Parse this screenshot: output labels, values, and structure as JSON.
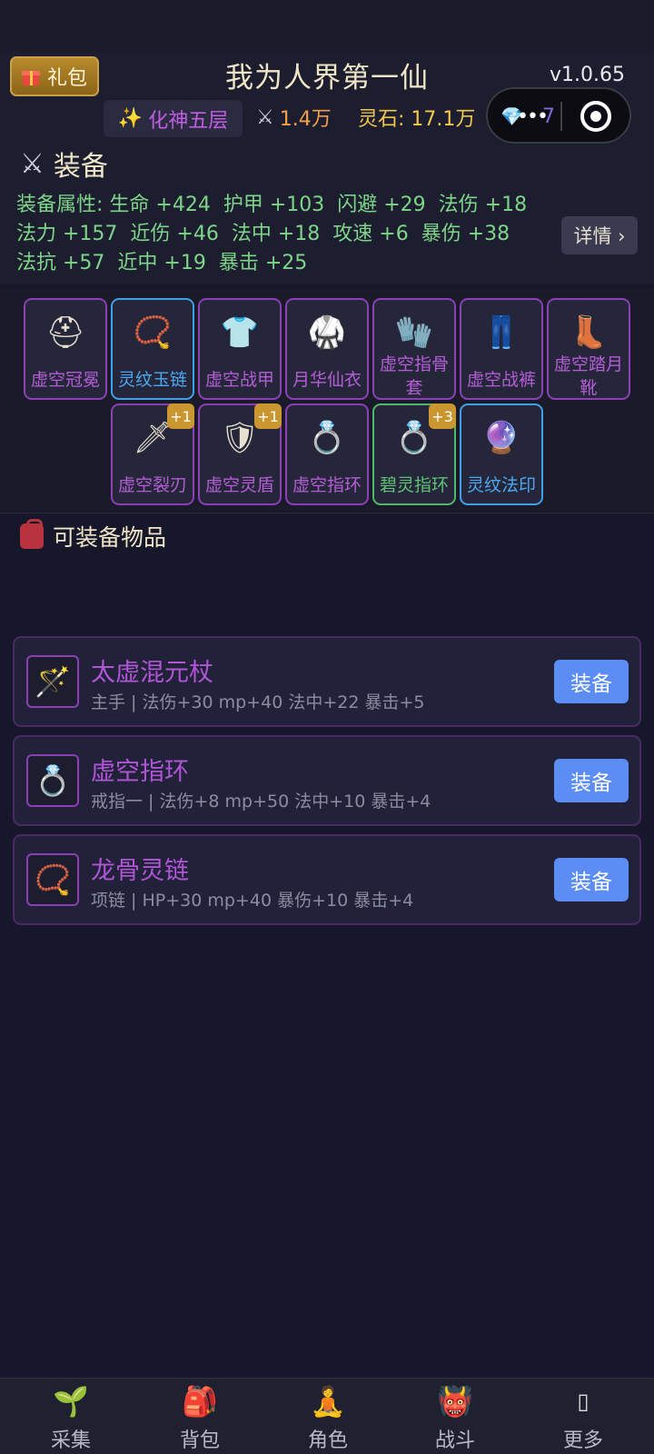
{
  "header": {
    "gift_label": "礼包",
    "app_title": "我为人界第一仙",
    "version": "v1.0.65",
    "realm": "化神五层",
    "power": "1.4万",
    "spirit_stones": "灵石: 17.1万",
    "capsule_value": "7"
  },
  "equipment": {
    "title": "装备",
    "stats_line1": [
      "装备属性: 生命 +424",
      "护甲 +103",
      "闪避 +29",
      "法伤 +18"
    ],
    "stats_line2": [
      "法力 +157",
      "近伤 +46",
      "法中 +18",
      "攻速 +6",
      "暴伤 +38"
    ],
    "stats_line3": [
      "法抗 +57",
      "近中 +19",
      "暴击 +25"
    ],
    "detail_label": "详情 ›",
    "slots": [
      {
        "name": "虚空冠冕",
        "icon": "helmet-icon",
        "rarity": "purple"
      },
      {
        "name": "灵纹玉链",
        "icon": "bead-necklace-icon",
        "rarity": "blue"
      },
      {
        "name": "虚空战甲",
        "icon": "shirt-icon",
        "rarity": "purple"
      },
      {
        "name": "月华仙衣",
        "icon": "martial-robe-icon",
        "rarity": "purple"
      },
      {
        "name": "虚空指骨套",
        "icon": "gloves-icon",
        "rarity": "purple"
      },
      {
        "name": "虚空战裤",
        "icon": "jeans-icon",
        "rarity": "purple"
      },
      {
        "name": "虚空踏月靴",
        "icon": "boot-icon",
        "rarity": "purple"
      },
      {
        "name": "虚空裂刃",
        "icon": "dagger-icon",
        "rarity": "purple",
        "plus": "+1"
      },
      {
        "name": "虚空灵盾",
        "icon": "shield-icon",
        "rarity": "purple",
        "plus": "+1"
      },
      {
        "name": "虚空指环",
        "icon": "ring-icon",
        "rarity": "purple"
      },
      {
        "name": "碧灵指环",
        "icon": "ring-icon",
        "rarity": "green",
        "plus": "+3"
      },
      {
        "name": "灵纹法印",
        "icon": "crystal-ball-icon",
        "rarity": "blue"
      }
    ]
  },
  "equippable": {
    "title": "可装备物品",
    "items": [
      {
        "name": "太虚混元杖",
        "attrs": "主手 | 法伤+30  mp+40  法中+22  暴击+5",
        "icon": "magic-wand-icon",
        "button": "装备"
      },
      {
        "name": "虚空指环",
        "attrs": "戒指一 | 法伤+8  mp+50  法中+10  暴击+4",
        "icon": "ring-icon",
        "button": "装备"
      },
      {
        "name": "龙骨灵链",
        "attrs": "项链 | HP+30  mp+40  暴伤+10  暴击+4",
        "icon": "bead-necklace-icon",
        "button": "装备"
      }
    ]
  },
  "tabs": [
    {
      "label": "采集",
      "icon": "seedling-icon"
    },
    {
      "label": "背包",
      "icon": "backpack-icon"
    },
    {
      "label": "角色",
      "icon": "meditation-icon"
    },
    {
      "label": "战斗",
      "icon": "oni-mask-icon"
    },
    {
      "label": "更多",
      "icon": "more-icon"
    }
  ],
  "colors": {
    "background": "#16172a",
    "purple_rarity": "#b155d6",
    "blue_rarity": "#4aa8f0",
    "green_rarity": "#5dc275",
    "stat_green": "#7ed58a",
    "button_blue": "#5b8df4"
  }
}
